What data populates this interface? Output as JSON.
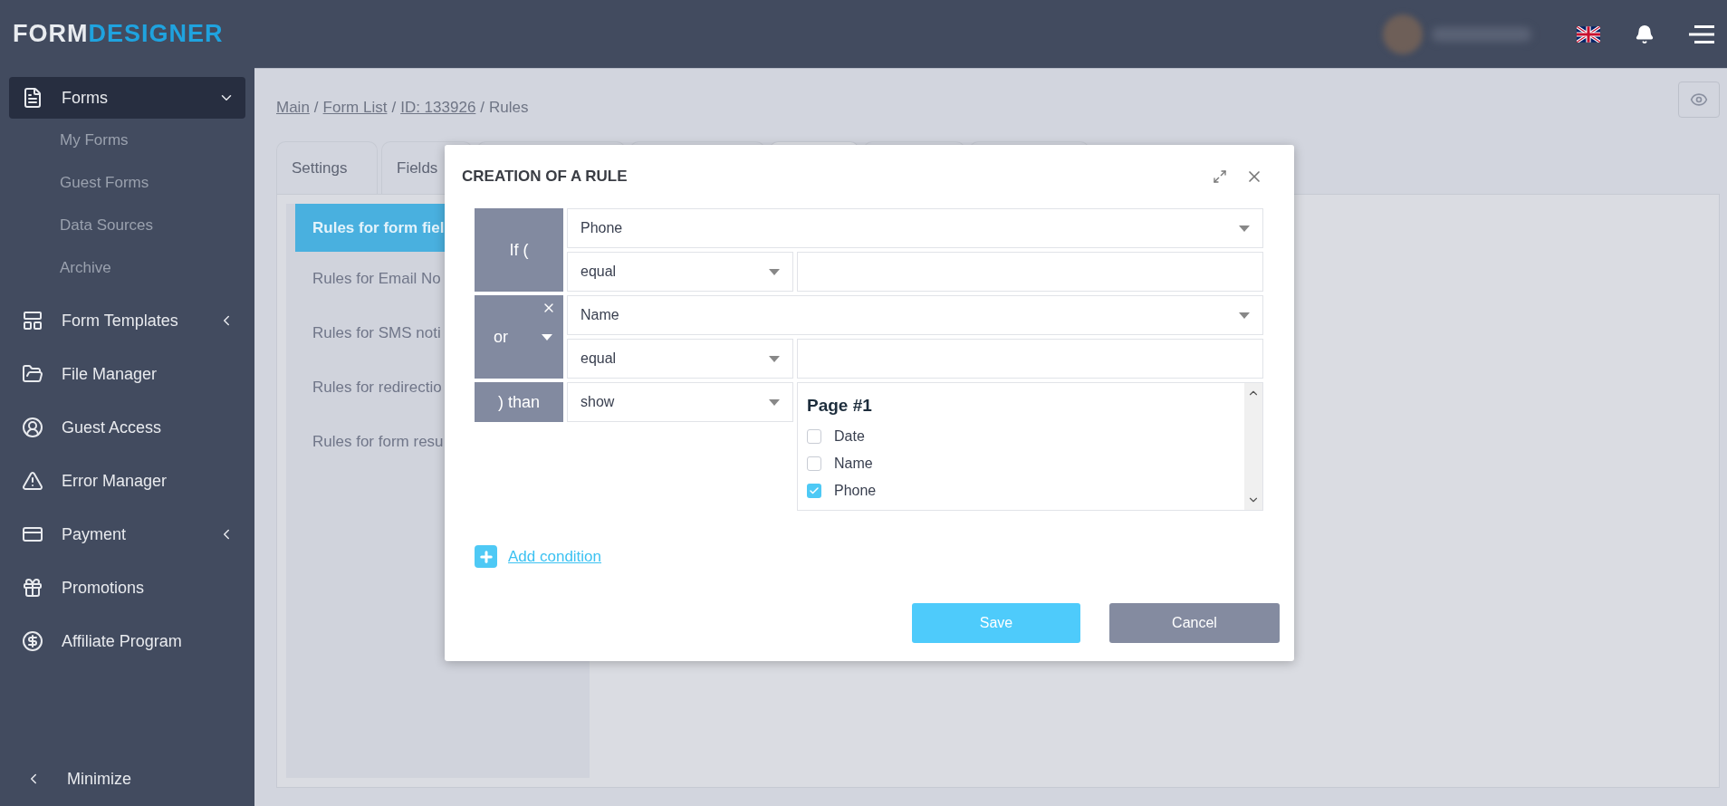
{
  "header": {
    "logo": {
      "part_1": "FORM",
      "part_2": "DESIGNER"
    }
  },
  "sidebar": {
    "items": [
      {
        "label": "Forms",
        "selected": true,
        "expanded": true,
        "children": [
          {
            "label": "My Forms"
          },
          {
            "label": "Guest Forms"
          },
          {
            "label": "Data Sources"
          },
          {
            "label": "Archive"
          }
        ]
      },
      {
        "label": "Form Templates",
        "selected": false,
        "expanded": false
      },
      {
        "label": "File Manager",
        "selected": false
      },
      {
        "label": "Guest Access",
        "selected": false
      },
      {
        "label": "Error Manager",
        "selected": false
      },
      {
        "label": "Payment",
        "selected": false,
        "expanded": false
      },
      {
        "label": "Promotions",
        "selected": false
      },
      {
        "label": "Affiliate Program",
        "selected": false
      }
    ],
    "minimize": "Minimize"
  },
  "breadcrumb": [
    {
      "kind": "link",
      "text": "Main"
    },
    {
      "kind": "separator",
      "text": "/"
    },
    {
      "kind": "link",
      "text": "Form List"
    },
    {
      "kind": "separator",
      "text": "/"
    },
    {
      "kind": "link",
      "text": "ID: 133926"
    },
    {
      "kind": "separator",
      "text": "/"
    },
    {
      "kind": "current",
      "text": "Rules"
    }
  ],
  "tabs": [
    {
      "label": "Settings",
      "selected": false
    },
    {
      "label": "Fields",
      "selected": false
    },
    {
      "selected": false
    },
    {
      "selected": false
    },
    {
      "selected": true
    },
    {
      "selected": false
    },
    {
      "selected": false
    }
  ],
  "rule_types": [
    {
      "label": "Rules for form fiel",
      "selected": true
    },
    {
      "label": "Rules for Email No",
      "selected": false
    },
    {
      "label": "Rules for SMS noti",
      "selected": false
    },
    {
      "label": "Rules for redirectio",
      "selected": false
    },
    {
      "label": "Rules for form resu",
      "selected": false
    }
  ],
  "dialog": {
    "title": "CREATION OF A RULE",
    "conditions": [
      {
        "kind": "first",
        "operator": "If (",
        "field": "Phone",
        "comparison": "equal"
      },
      {
        "kind": "extra",
        "operator": "or",
        "field": "Name",
        "comparison": "equal"
      }
    ],
    "action": {
      "label": ") than",
      "value": "show",
      "targets": {
        "heading": "Page #1",
        "items": [
          {
            "label": "Date",
            "checked": false
          },
          {
            "label": "Name",
            "checked": false
          },
          {
            "label": "Phone",
            "checked": true
          }
        ]
      }
    },
    "add_condition": "Add condition",
    "buttons": [
      {
        "label": "Save",
        "kind": "primary"
      },
      {
        "label": "Cancel",
        "kind": "secondary"
      }
    ]
  }
}
